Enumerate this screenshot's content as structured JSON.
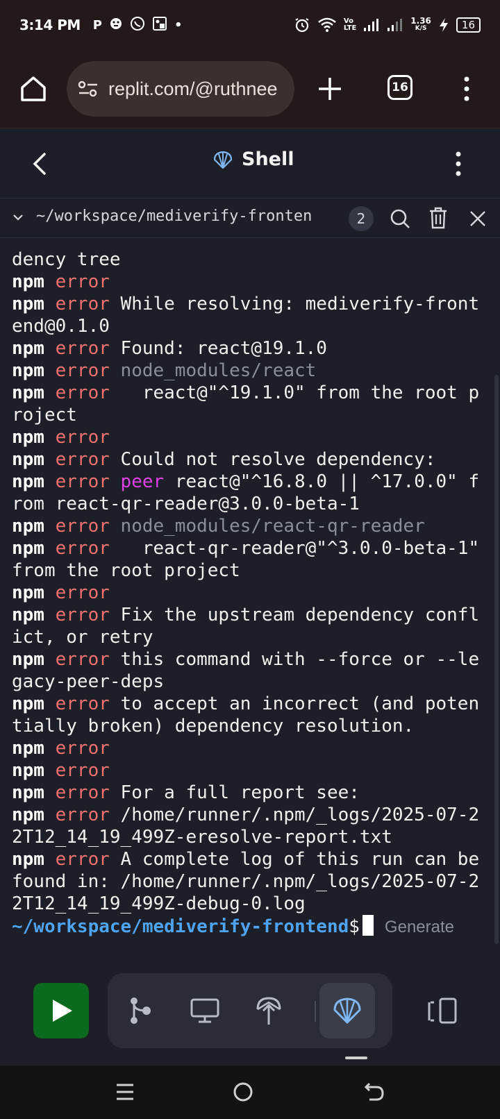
{
  "status_bar": {
    "time": "3:14 PM",
    "left_icons": [
      "p-app-icon",
      "bug-app-icon",
      "whatsapp-icon",
      "image-app-icon"
    ],
    "network_speed": "1.36",
    "network_speed_unit": "K/S",
    "network_label_top": "Vo",
    "network_label_bottom": "LTE",
    "battery": "16"
  },
  "browser": {
    "url": "replit.com/@ruthnee",
    "tab_count": "16"
  },
  "header": {
    "title": "Shell"
  },
  "path_bar": {
    "path": "~/workspace/mediverify-fronten",
    "count": "2"
  },
  "terminal": {
    "lines": [
      [
        {
          "t": "dency tree",
          "c": ""
        }
      ],
      [
        {
          "t": "npm",
          "c": "npm"
        },
        {
          "t": " error",
          "c": "err"
        }
      ],
      [
        {
          "t": "npm",
          "c": "npm"
        },
        {
          "t": " error",
          "c": "err"
        },
        {
          "t": " While resolving: mediverify-frontend@0.1.0",
          "c": ""
        }
      ],
      [
        {
          "t": "npm",
          "c": "npm"
        },
        {
          "t": " error",
          "c": "err"
        },
        {
          "t": " Found: react@19.1.0",
          "c": ""
        }
      ],
      [
        {
          "t": "npm",
          "c": "npm"
        },
        {
          "t": " error",
          "c": "err"
        },
        {
          "t": " node_modules/react",
          "c": "dim"
        }
      ],
      [
        {
          "t": "npm",
          "c": "npm"
        },
        {
          "t": " error",
          "c": "err"
        },
        {
          "t": "   react@\"^19.1.0\" from the root project",
          "c": ""
        }
      ],
      [
        {
          "t": "npm",
          "c": "npm"
        },
        {
          "t": " error",
          "c": "err"
        }
      ],
      [
        {
          "t": "npm",
          "c": "npm"
        },
        {
          "t": " error",
          "c": "err"
        },
        {
          "t": " Could not resolve dependency:",
          "c": ""
        }
      ],
      [
        {
          "t": "npm",
          "c": "npm"
        },
        {
          "t": " error",
          "c": "err"
        },
        {
          "t": " peer",
          "c": "peer"
        },
        {
          "t": " react@\"^16.8.0 || ^17.0.0\" from react-qr-reader@3.0.0-beta-1",
          "c": ""
        }
      ],
      [
        {
          "t": "npm",
          "c": "npm"
        },
        {
          "t": " error",
          "c": "err"
        },
        {
          "t": " node_modules/react-qr-reader",
          "c": "dim"
        }
      ],
      [
        {
          "t": "npm",
          "c": "npm"
        },
        {
          "t": " error",
          "c": "err"
        },
        {
          "t": "   react-qr-reader@\"^3.0.0-beta-1\" from the root project",
          "c": ""
        }
      ],
      [
        {
          "t": "npm",
          "c": "npm"
        },
        {
          "t": " error",
          "c": "err"
        }
      ],
      [
        {
          "t": "npm",
          "c": "npm"
        },
        {
          "t": " error",
          "c": "err"
        },
        {
          "t": " Fix the upstream dependency conflict, or retry",
          "c": ""
        }
      ],
      [
        {
          "t": "npm",
          "c": "npm"
        },
        {
          "t": " error",
          "c": "err"
        },
        {
          "t": " this command with --force or --legacy-peer-deps",
          "c": ""
        }
      ],
      [
        {
          "t": "npm",
          "c": "npm"
        },
        {
          "t": " error",
          "c": "err"
        },
        {
          "t": " to accept an incorrect (and potentially broken) dependency resolution.",
          "c": ""
        }
      ],
      [
        {
          "t": "npm",
          "c": "npm"
        },
        {
          "t": " error",
          "c": "err"
        }
      ],
      [
        {
          "t": "npm",
          "c": "npm"
        },
        {
          "t": " error",
          "c": "err"
        }
      ],
      [
        {
          "t": "npm",
          "c": "npm"
        },
        {
          "t": " error",
          "c": "err"
        },
        {
          "t": " For a full report see:",
          "c": ""
        }
      ],
      [
        {
          "t": "npm",
          "c": "npm"
        },
        {
          "t": " error",
          "c": "err"
        },
        {
          "t": " /home/runner/.npm/_logs/2025-07-22T12_14_19_499Z-eresolve-report.txt",
          "c": ""
        }
      ],
      [
        {
          "t": "npm",
          "c": "npm"
        },
        {
          "t": " error",
          "c": "err"
        },
        {
          "t": " A complete log of this run can be found in: /home/runner/.npm/_logs/2025-07-22T12_14_19_499Z-debug-0.log",
          "c": ""
        }
      ]
    ],
    "prompt_path": "~/workspace/mediverify-frontend",
    "prompt_symbol": "$",
    "generate_placeholder": "Generate"
  },
  "toolbar": {
    "items": [
      "run-icon",
      "git-icon",
      "preview-icon",
      "deploy-icon",
      "shell-icon",
      "layout-icon"
    ]
  },
  "colors": {
    "error": "#f0706e",
    "prompt": "#4ea4f2",
    "peer": "#e040e8",
    "run_button": "#0b6b1c",
    "browser_chrome": "#231918",
    "background": "#1c1f27"
  }
}
